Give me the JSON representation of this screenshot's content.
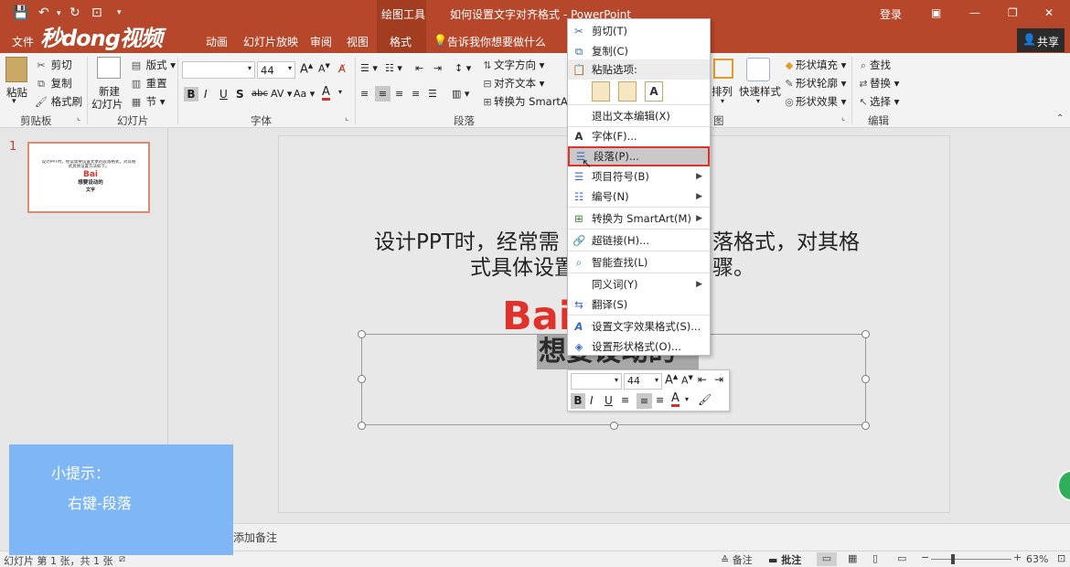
{
  "title_bar": {
    "context_tool": "绘图工具",
    "doc_title": "如何设置文字对齐格式 - PowerPoint",
    "login": "登录"
  },
  "tabs": {
    "file": "文件",
    "animation": "动画",
    "slideshow": "幻灯片放映",
    "review": "审阅",
    "view": "视图",
    "format": "格式",
    "tellme": "告诉我你想要做什么",
    "share": "共享"
  },
  "watermark": "秒dong视频",
  "ribbon": {
    "clipboard": {
      "paste": "粘贴",
      "cut": "剪切",
      "copy": "复制",
      "format_painter": "格式刷",
      "label": "剪贴板"
    },
    "slides": {
      "new_slide_1": "新建",
      "new_slide_2": "幻灯片",
      "layout": "版式",
      "reset": "重置",
      "section": "节",
      "label": "幻灯片"
    },
    "font": {
      "size": "44",
      "label": "字体"
    },
    "paragraph": {
      "text_direction": "文字方向",
      "align_text": "对齐文本",
      "smartart": "转换为 SmartArt",
      "label": "段落"
    },
    "drawing": {
      "arrange": "排列",
      "quick_styles": "快速样式",
      "shape_fill": "形状填充",
      "shape_outline": "形状轮廓",
      "shape_effects": "形状效果",
      "label": "图"
    },
    "editing": {
      "find": "查找",
      "replace": "替换",
      "select": "选择",
      "label": "编辑"
    }
  },
  "thumbnail": {
    "number": "1",
    "line1": "设计PPT时，经常需要设置文本的段落格式，对其格",
    "line2": "式具体设置方法如下。",
    "logo": "Bai",
    "sub": "想要设动的",
    "sub2": "文字"
  },
  "slide": {
    "text_line1_a": "设计PPT时，经常需",
    "text_line1_b": "落格式，对其格",
    "text_line2_a": "式具体设置",
    "text_line2_b": "骤。",
    "logo": "Bai",
    "selected_text": "想要设动的"
  },
  "context_menu": {
    "cut": "剪切(T)",
    "copy": "复制(C)",
    "paste_options": "粘贴选项:",
    "exit_edit": "退出文本编辑(X)",
    "font": "字体(F)...",
    "paragraph": "段落(P)...",
    "bullets": "项目符号(B)",
    "numbering": "编号(N)",
    "smartart": "转换为 SmartArt(M)",
    "hyperlink": "超链接(H)...",
    "smart_lookup": "智能查找(L)",
    "synonyms": "同义词(Y)",
    "translate": "翻译(S)",
    "text_effects": "设置文字效果格式(S)...",
    "shape_format": "设置形状格式(O)..."
  },
  "mini_toolbar": {
    "size": "44"
  },
  "notes": {
    "placeholder": "添加备注"
  },
  "status": {
    "slide_info": "幻灯片 第 1 张，共 1 张",
    "notes": "备注",
    "comments": "批注",
    "zoom": "63%"
  },
  "tip": {
    "title": "小提示：",
    "body": "右键-段落"
  },
  "colors": {
    "accent": "#b7472a",
    "highlight": "#e0322a",
    "tip_bg": "#7eb6f6"
  }
}
